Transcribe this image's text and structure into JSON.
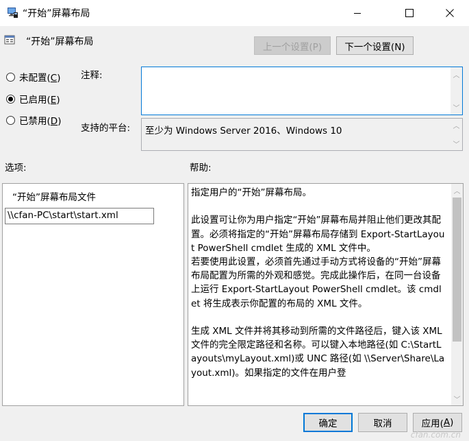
{
  "window": {
    "title": "“开始”屏幕布局"
  },
  "header": {
    "title": "“开始”屏幕布局",
    "prev_button": "上一个设置(P)",
    "next_button": "下一个设置(N)"
  },
  "radios": [
    {
      "label": "未配置(",
      "key": "C",
      "suffix": ")",
      "checked": false
    },
    {
      "label": "已启用(",
      "key": "E",
      "suffix": ")",
      "checked": true
    },
    {
      "label": "已禁用(",
      "key": "D",
      "suffix": ")",
      "checked": false
    }
  ],
  "comment": {
    "label": "注释:",
    "value": ""
  },
  "platform": {
    "label": "支持的平台:",
    "value": "至少为 Windows Server 2016、Windows 10"
  },
  "options": {
    "label": "选项:",
    "field_label": "“开始”屏幕布局文件",
    "path_value": "\\\\cfan-PC\\start\\start.xml"
  },
  "help": {
    "label": "帮助:",
    "text": "指定用户的“开始”屏幕布局。\n\n此设置可让你为用户指定“开始”屏幕布局并阻止他们更改其配置。必须将指定的“开始”屏幕布局存储到 Export-StartLayout PowerShell cmdlet 生成的 XML 文件中。\n若要使用此设置，必须首先通过手动方式将设备的“开始”屏幕布局配置为所需的外观和感觉。完成此操作后，在同一台设备上运行 Export-StartLayout PowerShell cmdlet。该 cmdlet 将生成表示你配置的布局的 XML 文件。\n\n生成 XML 文件并将其移动到所需的文件路径后，键入该 XML 文件的完全限定路径和名称。可以键入本地路径(如 C:\\StartLayouts\\myLayout.xml)或 UNC 路径(如 \\\\Server\\Share\\Layout.xml)。如果指定的文件在用户登"
  },
  "footer": {
    "ok": "确定",
    "cancel": "取消",
    "apply_label": "应用(",
    "apply_key": "A",
    "apply_suffix": ")"
  },
  "watermark": "cfan.com.cn"
}
